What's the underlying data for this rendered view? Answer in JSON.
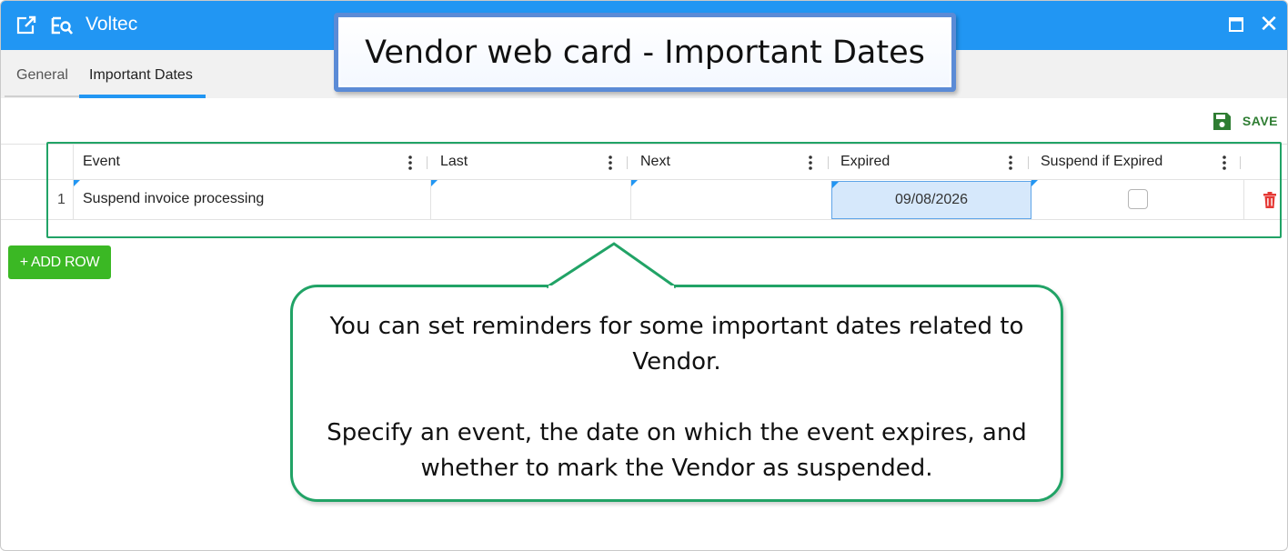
{
  "window": {
    "title": "Voltec"
  },
  "tabs": [
    {
      "label": "General",
      "active": false
    },
    {
      "label": "Important Dates",
      "active": true
    }
  ],
  "toolbar": {
    "save_label": "SAVE"
  },
  "grid": {
    "columns": [
      "Event",
      "Last",
      "Next",
      "Expired",
      "Suspend if Expired"
    ],
    "rows": [
      {
        "number": "1",
        "event": "Suspend invoice processing",
        "last": "",
        "next": "",
        "expired": "09/08/2026",
        "suspend_if_expired": false
      }
    ]
  },
  "add_row_label": "+ ADD ROW",
  "callouts": {
    "title": "Vendor web card - Important Dates",
    "bubble_line1": "You can set reminders for some important dates related to",
    "bubble_line2": "Vendor.",
    "bubble_line3": "Specify an event, the date on which the event expires, and",
    "bubble_line4": "whether to mark the Vendor as suspended."
  },
  "colors": {
    "titlebar": "#2196f3",
    "accent_green": "#21a366",
    "add_button": "#3bb824",
    "save": "#2e7d32",
    "delete": "#e53935",
    "callout_border": "#5b8bd6"
  }
}
